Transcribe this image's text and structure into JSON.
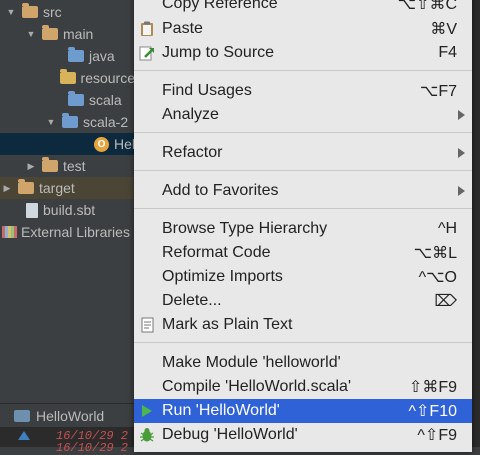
{
  "tree": [
    {
      "label": "src",
      "indent": 0,
      "arrow": "▼",
      "icon": "folder-orange-icon"
    },
    {
      "label": "main",
      "indent": 1,
      "arrow": "▼",
      "icon": "folder-orange-icon"
    },
    {
      "label": "java",
      "indent": 2,
      "arrow": "",
      "icon": "folder-blue-icon"
    },
    {
      "label": "resource",
      "indent": 2,
      "arrow": "",
      "icon": "folder-yellow-icon"
    },
    {
      "label": "scala",
      "indent": 2,
      "arrow": "",
      "icon": "folder-blue-icon"
    },
    {
      "label": "scala-2",
      "indent": 2,
      "arrow": "▼",
      "icon": "folder-blue-icon"
    },
    {
      "label": "Hell",
      "indent": 3,
      "arrow": "",
      "icon": "object-file-icon",
      "selected": true
    },
    {
      "label": "test",
      "indent": 1,
      "arrow": "▶",
      "icon": "folder-orange-icon"
    },
    {
      "label": "target",
      "indent": 0,
      "arrow": "▶",
      "icon": "folder-orange-icon",
      "highlight": true
    },
    {
      "label": "build.sbt",
      "indent": 0,
      "arrow": "",
      "icon": "sbt-file-icon"
    },
    {
      "label": "External Libraries",
      "indent": -1,
      "arrow": "",
      "icon": "libraries-icon"
    }
  ],
  "bottom": {
    "tab_label": "HelloWorld",
    "log1": "16/10/29 2",
    "log2": "16/10/29 2"
  },
  "menu": [
    {
      "label": "Copy Reference",
      "shortcut": "⌥⇧⌘C"
    },
    {
      "label": "Paste",
      "shortcut": "⌘V",
      "icon": "paste-icon"
    },
    {
      "label": "Jump to Source",
      "shortcut": "F4",
      "icon": "jump-to-source-icon"
    },
    {
      "label": "Find Usages",
      "shortcut": "⌥F7"
    },
    {
      "label": "Analyze",
      "submenu": true
    },
    {
      "label": "Refactor",
      "submenu": true
    },
    {
      "label": "Add to Favorites",
      "submenu": true
    },
    {
      "label": "Browse Type Hierarchy",
      "shortcut": "^H"
    },
    {
      "label": "Reformat Code",
      "shortcut": "⌥⌘L"
    },
    {
      "label": "Optimize Imports",
      "shortcut": "^⌥O"
    },
    {
      "label": "Delete...",
      "shortcut": "⌦"
    },
    {
      "label": "Mark as Plain Text",
      "icon": "plain-text-icon"
    },
    {
      "label": "Make Module 'helloworld'"
    },
    {
      "label": "Compile 'HelloWorld.scala'",
      "shortcut": "⇧⌘F9"
    },
    {
      "label": "Run 'HelloWorld'",
      "shortcut": "^⇧F10",
      "icon": "run-icon",
      "active": true
    },
    {
      "label": "Debug 'HelloWorld'",
      "shortcut": "^⇧F9",
      "icon": "debug-icon"
    }
  ]
}
